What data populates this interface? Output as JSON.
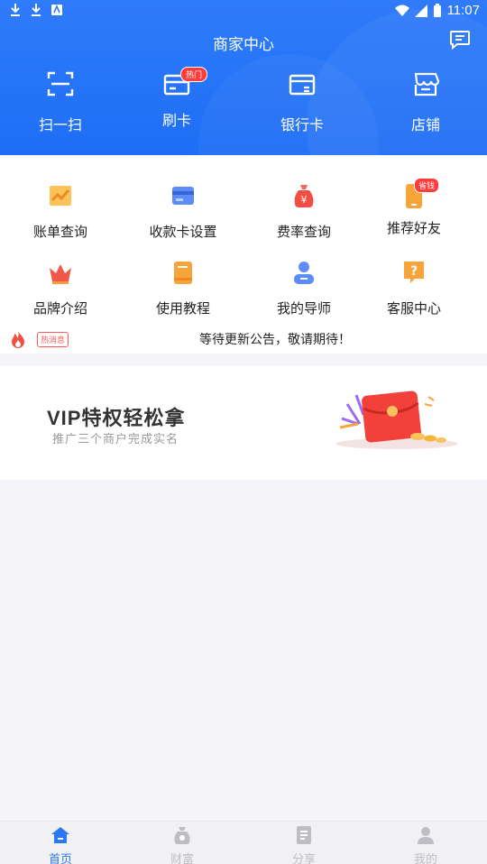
{
  "status_bar": {
    "time": "11:07"
  },
  "header": {
    "title": "商家中心"
  },
  "quick_actions": [
    {
      "label": "扫一扫",
      "icon": "scan-icon"
    },
    {
      "label": "刷卡",
      "icon": "card-swipe-icon",
      "badge": "热门"
    },
    {
      "label": "银行卡",
      "icon": "bank-card-icon"
    },
    {
      "label": "店铺",
      "icon": "store-icon"
    }
  ],
  "menu": [
    {
      "label": "账单查询",
      "icon": "bill-chart-icon"
    },
    {
      "label": "收款卡设置",
      "icon": "payment-card-icon"
    },
    {
      "label": "费率查询",
      "icon": "money-bag-icon"
    },
    {
      "label": "推荐好友",
      "icon": "phone-recommend-icon",
      "badge": "省钱"
    },
    {
      "label": "品牌介绍",
      "icon": "crown-icon"
    },
    {
      "label": "使用教程",
      "icon": "book-icon"
    },
    {
      "label": "我的导师",
      "icon": "mentor-user-icon"
    },
    {
      "label": "客服中心",
      "icon": "help-icon"
    }
  ],
  "notice": {
    "tag": "热消息",
    "text": "等待更新公告，敬请期待！"
  },
  "banner": {
    "title": "VIP特权轻松拿",
    "subtitle": "推广三个商户完成实名"
  },
  "bottom_nav": [
    {
      "label": "首页",
      "icon": "home-icon",
      "active": true
    },
    {
      "label": "财富",
      "icon": "wealth-bag-icon",
      "active": false
    },
    {
      "label": "分享",
      "icon": "share-doc-icon",
      "active": false
    },
    {
      "label": "我的",
      "icon": "profile-icon",
      "active": false
    }
  ],
  "colors": {
    "primary": "#2b78f6",
    "badge_red": "#ff3b3b",
    "icon_orange": "#f7a43a"
  }
}
